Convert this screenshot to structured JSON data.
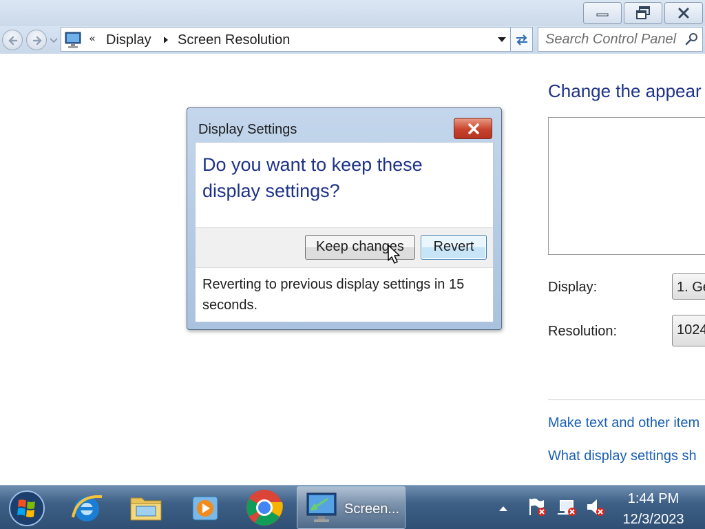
{
  "window": {
    "minimize_icon": "minimize-icon",
    "maximize_icon": "restore-icon",
    "close_icon": "close-icon"
  },
  "navigation": {
    "breadcrumb": [
      "Display",
      "Screen Resolution"
    ],
    "overflow_chevron": "«",
    "search_placeholder": "Search Control Panel"
  },
  "main": {
    "heading": "Change the appear",
    "display_label": "Display:",
    "display_value": "1. Ge",
    "resolution_label": "Resolution:",
    "resolution_value": "1024",
    "links": [
      "Make text and other item",
      "What display settings sh"
    ]
  },
  "dialog": {
    "title": "Display Settings",
    "question": "Do you want to keep these display settings?",
    "keep_button": "Keep changes",
    "revert_button": "Revert",
    "footer": "Reverting to previous display settings in 15 seconds."
  },
  "taskbar": {
    "active_window_label": "Screen...",
    "time": "1:44 PM",
    "date": "12/3/2023"
  },
  "colors": {
    "heading": "#1e3287",
    "link": "#1a5fb4",
    "taskbar": "#3e6086",
    "dialog_close": "#c8432c"
  }
}
